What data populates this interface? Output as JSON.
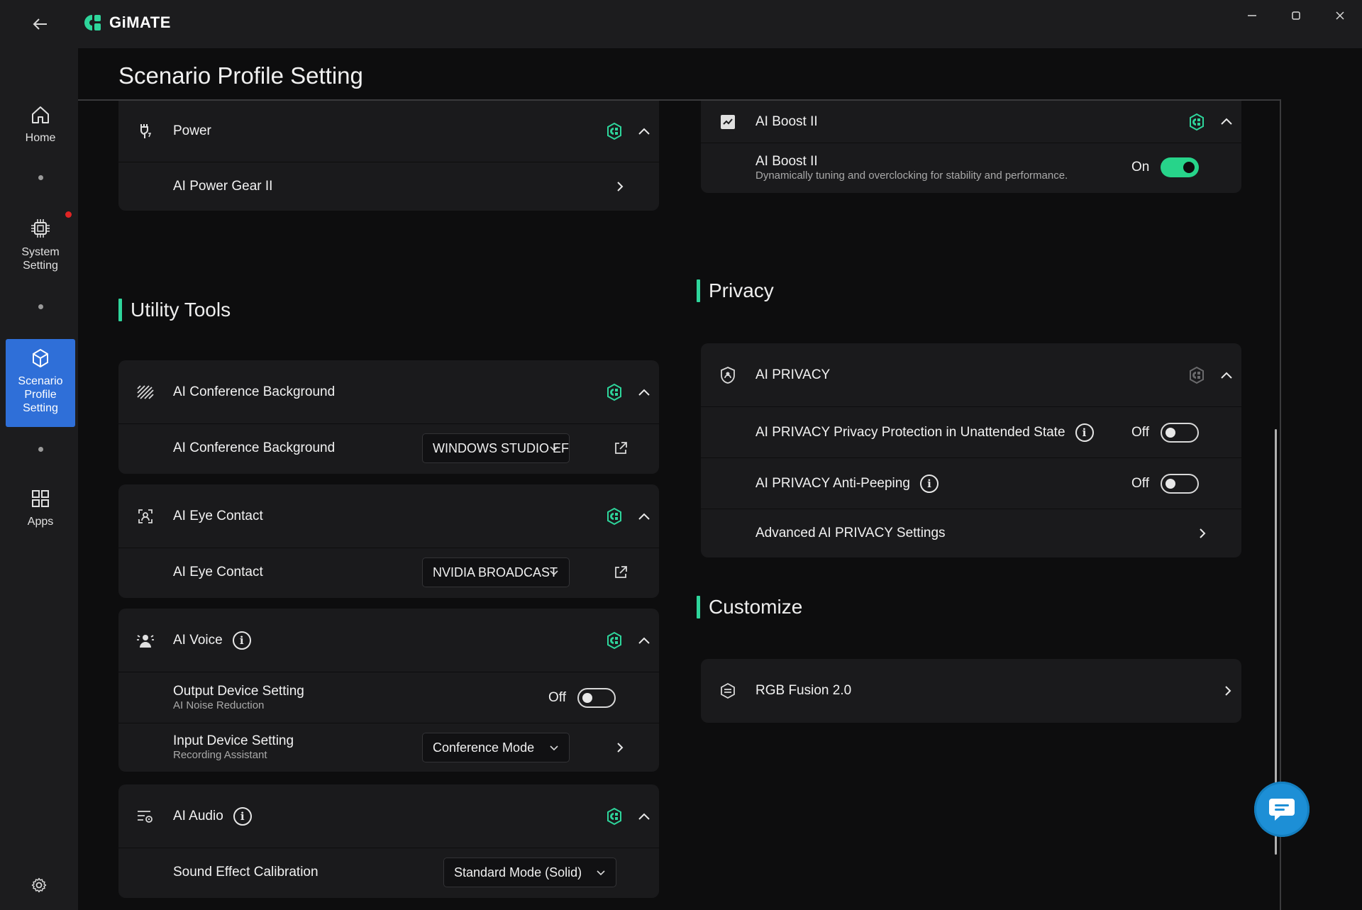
{
  "app": {
    "brand": "GiMATE",
    "colors": {
      "accent": "#2ed59b",
      "active_nav": "#2f6fd8",
      "toggle_on": "#27d48a",
      "alert": "#e02424"
    }
  },
  "sidebar": {
    "items": [
      {
        "label": "Home",
        "icon": "home-icon"
      },
      {
        "label": "System Setting",
        "icon": "chip-icon"
      },
      {
        "label": "Scenario Profile Setting",
        "icon": "cube-icon",
        "active": true
      },
      {
        "label": "Apps",
        "icon": "grid-icon"
      }
    ]
  },
  "page": {
    "title": "Scenario Profile Setting"
  },
  "left": {
    "power": {
      "title": "Power",
      "rows": [
        {
          "label": "AI Power Gear II"
        }
      ]
    },
    "utility_title": "Utility Tools",
    "conference": {
      "title": "AI Conference Background",
      "row_label": "AI Conference Background",
      "select_value": "WINDOWS STUDIO EF"
    },
    "eye": {
      "title": "AI Eye Contact",
      "row_label": "AI Eye Contact",
      "select_value": "NVIDIA BROADCAST"
    },
    "voice": {
      "title": "AI Voice",
      "info": "i",
      "output": {
        "title": "Output Device Setting",
        "sub": "AI Noise Reduction",
        "state": "Off"
      },
      "input": {
        "title": "Input Device Setting",
        "sub": "Recording Assistant",
        "select_value": "Conference Mode"
      }
    },
    "audio": {
      "title": "AI Audio",
      "info": "i",
      "row_label": "Sound Effect Calibration",
      "select_value": "Standard Mode (Solid)"
    }
  },
  "right": {
    "boost": {
      "title": "AI Boost II",
      "row_title": "AI Boost II",
      "row_sub": "Dynamically tuning and overclocking for stability and performance.",
      "state": "On"
    },
    "privacy_title": "Privacy",
    "privacy": {
      "title": "AI PRIVACY",
      "rows": [
        {
          "label": "AI PRIVACY Privacy Protection in Unattended State",
          "info": "i",
          "state": "Off"
        },
        {
          "label": "AI PRIVACY Anti-Peeping",
          "info": "i",
          "state": "Off"
        }
      ],
      "advanced": "Advanced AI PRIVACY Settings"
    },
    "customize_title": "Customize",
    "rgb": {
      "title": "RGB Fusion 2.0"
    }
  }
}
